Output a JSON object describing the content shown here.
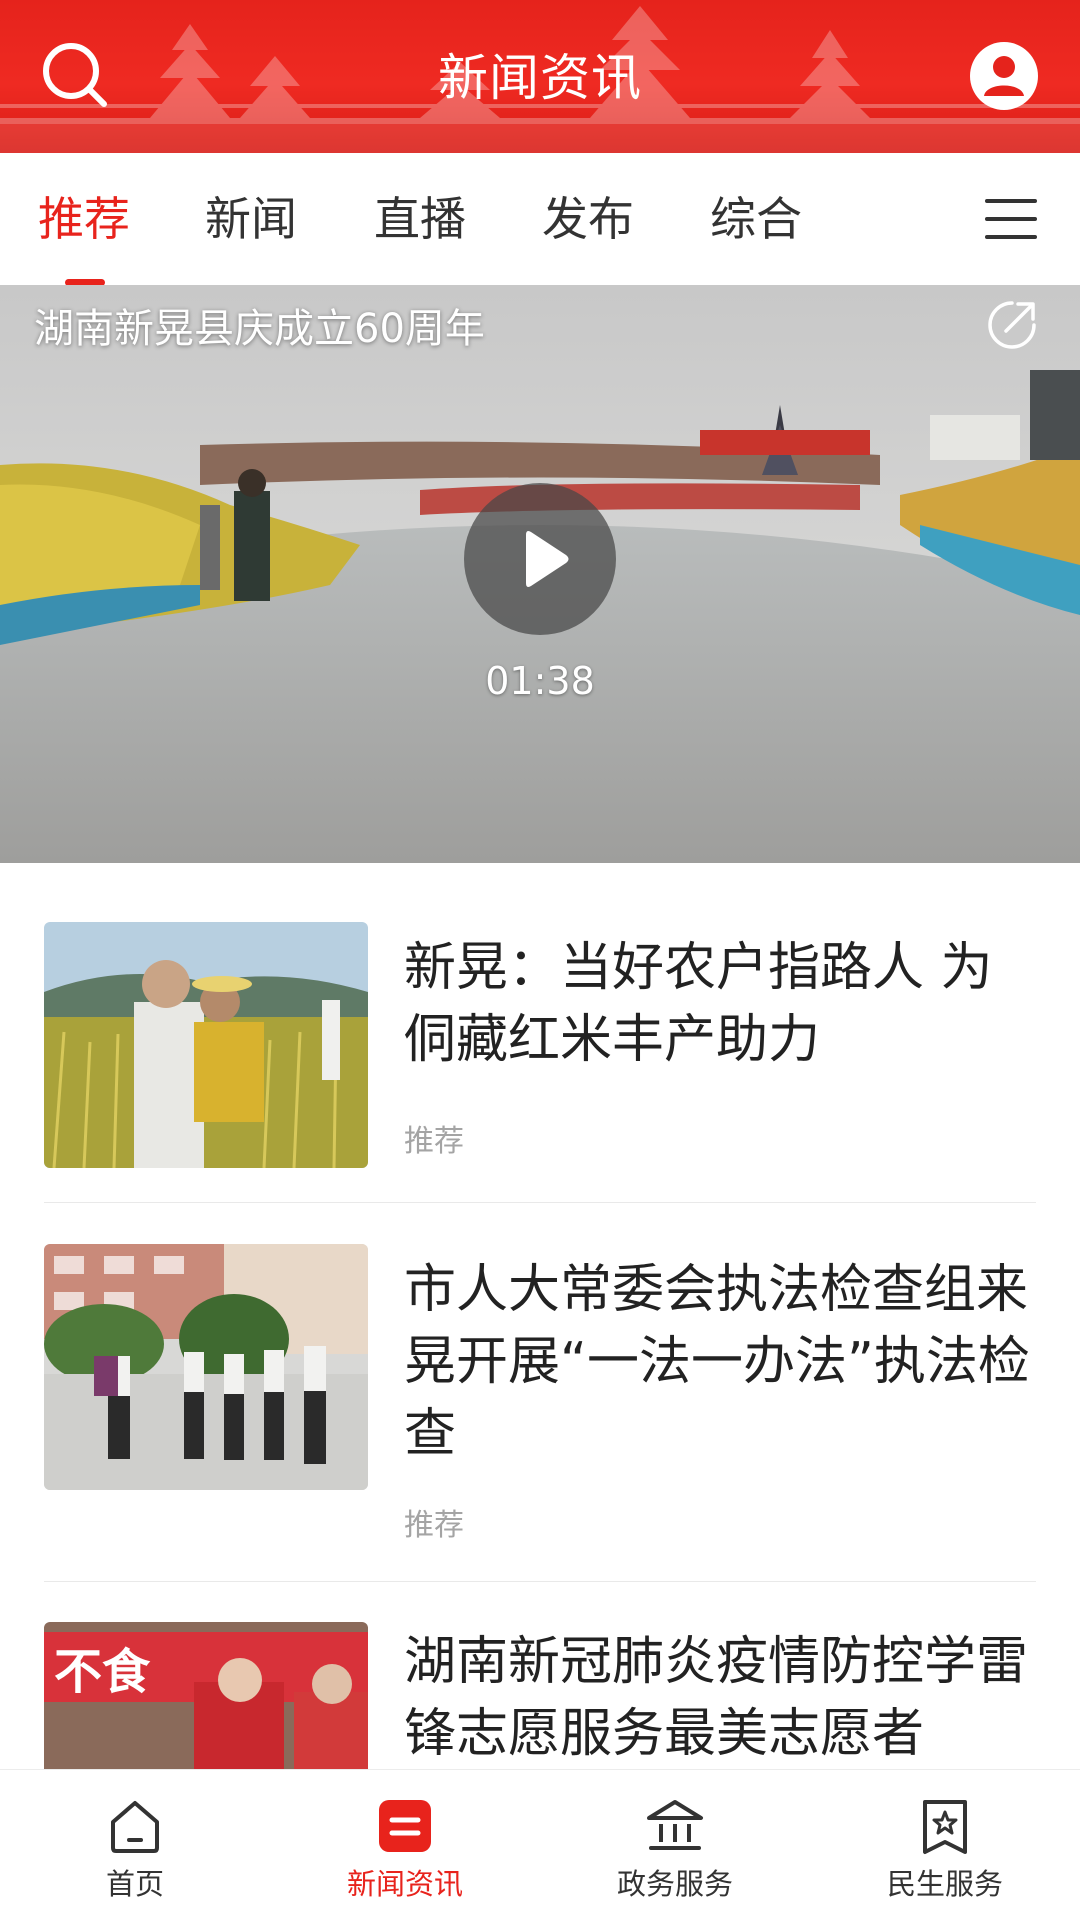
{
  "header": {
    "title": "新闻资讯",
    "search_icon": "search-icon",
    "account_icon": "user-account-icon"
  },
  "tabs": {
    "items": [
      {
        "label": "推荐",
        "active": true
      },
      {
        "label": "新闻",
        "active": false
      },
      {
        "label": "直播",
        "active": false
      },
      {
        "label": "发布",
        "active": false
      },
      {
        "label": "综合",
        "active": false
      }
    ],
    "menu_icon": "hamburger-menu-icon"
  },
  "featured_video": {
    "title": "湖南新晃县庆成立60周年",
    "duration": "01:38",
    "share_icon": "share-icon",
    "play_icon": "play-icon"
  },
  "news": [
    {
      "title": "新晃：当好农户指路人 为侗藏红米丰产助力",
      "tag": "推荐"
    },
    {
      "title": "市人大常委会执法检查组来晃开展“一法一办法”执法检查",
      "tag": "推荐"
    },
    {
      "title": "湖南新冠肺炎疫情防控学雷锋志愿服务最美志愿者",
      "tag": ""
    }
  ],
  "bottom_nav": {
    "items": [
      {
        "label": "首页",
        "icon": "home-icon",
        "active": false
      },
      {
        "label": "新闻资讯",
        "icon": "news-icon",
        "active": true
      },
      {
        "label": "政务服务",
        "icon": "government-building-icon",
        "active": false
      },
      {
        "label": "民生服务",
        "icon": "bookmark-star-icon",
        "active": false
      }
    ]
  },
  "colors": {
    "brand_red": "#e8231c",
    "text_primary": "#222222",
    "text_secondary": "#a4a4a4"
  }
}
